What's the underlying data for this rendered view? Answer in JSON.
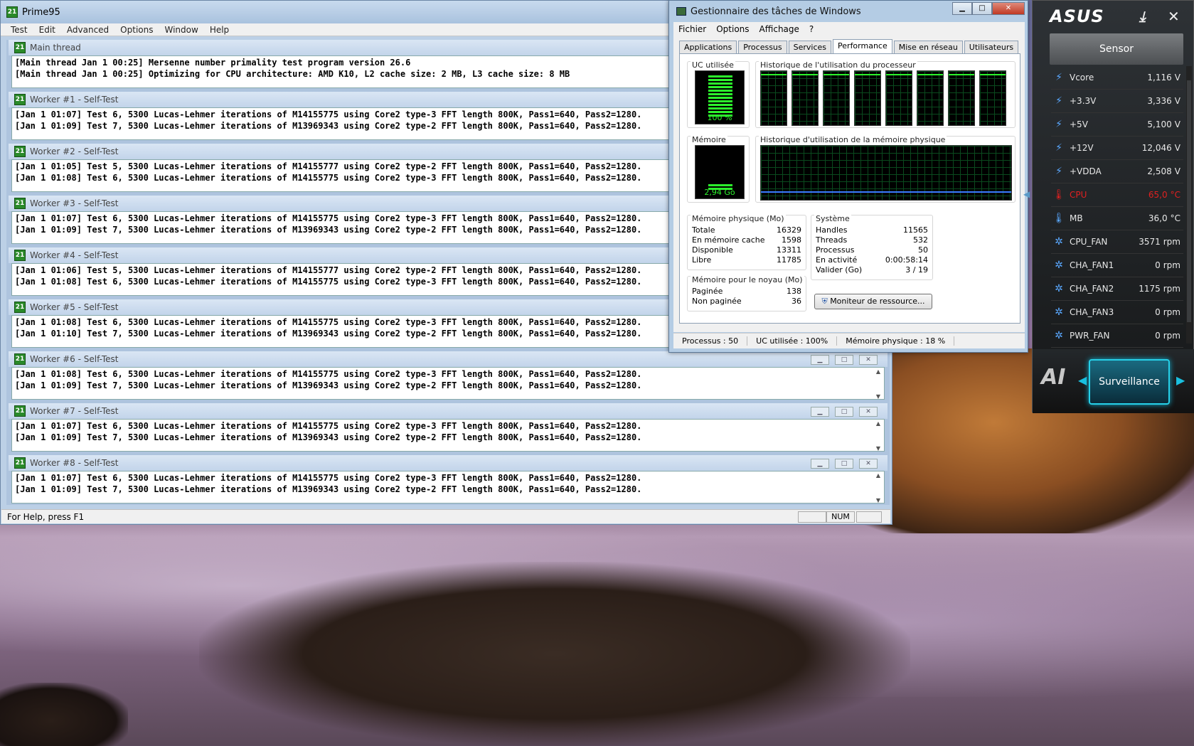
{
  "prime95": {
    "title": "Prime95",
    "menu": [
      "Test",
      "Edit",
      "Advanced",
      "Options",
      "Window",
      "Help"
    ],
    "windows": [
      {
        "title": "Main thread",
        "lines": [
          "[Main thread Jan 1 00:25] Mersenne number primality test program version 26.6",
          "[Main thread Jan 1 00:25] Optimizing for CPU architecture: AMD K10, L2 cache size: 2 MB, L3 cache size: 8 MB"
        ]
      },
      {
        "title": "Worker #1 - Self-Test",
        "lines": [
          "[Jan 1 01:07] Test 6, 5300 Lucas-Lehmer iterations of M14155775 using Core2 type-3 FFT length 800K, Pass1=640, Pass2=1280.",
          "[Jan 1 01:09] Test 7, 5300 Lucas-Lehmer iterations of M13969343 using Core2 type-2 FFT length 800K, Pass1=640, Pass2=1280."
        ]
      },
      {
        "title": "Worker #2 - Self-Test",
        "lines": [
          "[Jan 1 01:05] Test 5, 5300 Lucas-Lehmer iterations of M14155777 using Core2 type-2 FFT length 800K, Pass1=640, Pass2=1280.",
          "[Jan 1 01:08] Test 6, 5300 Lucas-Lehmer iterations of M14155775 using Core2 type-3 FFT length 800K, Pass1=640, Pass2=1280."
        ]
      },
      {
        "title": "Worker #3 - Self-Test",
        "lines": [
          "[Jan 1 01:07] Test 6, 5300 Lucas-Lehmer iterations of M14155775 using Core2 type-3 FFT length 800K, Pass1=640, Pass2=1280.",
          "[Jan 1 01:09] Test 7, 5300 Lucas-Lehmer iterations of M13969343 using Core2 type-2 FFT length 800K, Pass1=640, Pass2=1280."
        ]
      },
      {
        "title": "Worker #4 - Self-Test",
        "lines": [
          "[Jan 1 01:06] Test 5, 5300 Lucas-Lehmer iterations of M14155777 using Core2 type-2 FFT length 800K, Pass1=640, Pass2=1280.",
          "[Jan 1 01:08] Test 6, 5300 Lucas-Lehmer iterations of M14155775 using Core2 type-3 FFT length 800K, Pass1=640, Pass2=1280."
        ]
      },
      {
        "title": "Worker #5 - Self-Test",
        "lines": [
          "[Jan 1 01:08] Test 6, 5300 Lucas-Lehmer iterations of M14155775 using Core2 type-3 FFT length 800K, Pass1=640, Pass2=1280.",
          "[Jan 1 01:10] Test 7, 5300 Lucas-Lehmer iterations of M13969343 using Core2 type-2 FFT length 800K, Pass1=640, Pass2=1280."
        ]
      },
      {
        "title": "Worker #6 - Self-Test",
        "lines": [
          "[Jan 1 01:08] Test 6, 5300 Lucas-Lehmer iterations of M14155775 using Core2 type-3 FFT length 800K, Pass1=640, Pass2=1280.",
          "[Jan 1 01:09] Test 7, 5300 Lucas-Lehmer iterations of M13969343 using Core2 type-2 FFT length 800K, Pass1=640, Pass2=1280."
        ]
      },
      {
        "title": "Worker #7 - Self-Test",
        "lines": [
          "[Jan 1 01:07] Test 6, 5300 Lucas-Lehmer iterations of M14155775 using Core2 type-3 FFT length 800K, Pass1=640, Pass2=1280.",
          "[Jan 1 01:09] Test 7, 5300 Lucas-Lehmer iterations of M13969343 using Core2 type-2 FFT length 800K, Pass1=640, Pass2=1280."
        ]
      },
      {
        "title": "Worker #8 - Self-Test",
        "lines": [
          "[Jan 1 01:07] Test 6, 5300 Lucas-Lehmer iterations of M14155775 using Core2 type-3 FFT length 800K, Pass1=640, Pass2=1280.",
          "[Jan 1 01:09] Test 7, 5300 Lucas-Lehmer iterations of M13969343 using Core2 type-2 FFT length 800K, Pass1=640, Pass2=1280."
        ]
      }
    ],
    "status_help": "For Help, press F1",
    "status_num": "NUM"
  },
  "taskmgr": {
    "title": "Gestionnaire des tâches de Windows",
    "menu": [
      "Fichier",
      "Options",
      "Affichage",
      "?"
    ],
    "tabs": [
      "Applications",
      "Processus",
      "Services",
      "Performance",
      "Mise en réseau",
      "Utilisateurs"
    ],
    "active_tab": "Performance",
    "cpu_label": "UC utilisée",
    "cpu_value": "100 %",
    "cpu_fraction": 1.0,
    "cpu_history_label": "Historique de l'utilisation du processeur",
    "mem_label": "Mémoire",
    "mem_value": "2,94 Go",
    "mem_fraction": 0.18,
    "mem_history_label": "Historique d'utilisation de la mémoire physique",
    "phys_mem": {
      "label": "Mémoire physique (Mo)",
      "rows": [
        [
          "Totale",
          "16329"
        ],
        [
          "En mémoire cache",
          "1598"
        ],
        [
          "Disponible",
          "13311"
        ],
        [
          "Libre",
          "11785"
        ]
      ]
    },
    "system": {
      "label": "Système",
      "rows": [
        [
          "Handles",
          "11565"
        ],
        [
          "Threads",
          "532"
        ],
        [
          "Processus",
          "50"
        ],
        [
          "En activité",
          "0:00:58:14"
        ],
        [
          "Valider (Go)",
          "3 / 19"
        ]
      ]
    },
    "kernel_mem": {
      "label": "Mémoire pour le noyau (Mo)",
      "rows": [
        [
          "Paginée",
          "138"
        ],
        [
          "Non paginée",
          "36"
        ]
      ]
    },
    "resource_button": "Moniteur de ressource...",
    "status": [
      "Processus : 50",
      "UC utilisée : 100%",
      "Mémoire physique : 18 %"
    ]
  },
  "asus": {
    "logo": "ASUS",
    "panel": "Sensor",
    "sensors": [
      {
        "name": "Vcore",
        "value": "1,116",
        "unit": "V",
        "icon": "bolt-icon"
      },
      {
        "name": "+3.3V",
        "value": "3,336",
        "unit": "V",
        "icon": "bolt-icon"
      },
      {
        "name": "+5V",
        "value": "5,100",
        "unit": "V",
        "icon": "bolt-icon"
      },
      {
        "name": "+12V",
        "value": "12,046",
        "unit": "V",
        "icon": "bolt-icon"
      },
      {
        "name": "+VDDA",
        "value": "2,508",
        "unit": "V",
        "icon": "bolt-icon"
      },
      {
        "name": "CPU",
        "value": "65,0",
        "unit": "°C",
        "icon": "thermometer-icon",
        "alert": true
      },
      {
        "name": "MB",
        "value": "36,0",
        "unit": "°C",
        "icon": "thermometer-icon"
      },
      {
        "name": "CPU_FAN",
        "value": "3571",
        "unit": "rpm",
        "icon": "fan-icon"
      },
      {
        "name": "CHA_FAN1",
        "value": "0",
        "unit": "rpm",
        "icon": "fan-icon"
      },
      {
        "name": "CHA_FAN2",
        "value": "1175",
        "unit": "rpm",
        "icon": "fan-icon"
      },
      {
        "name": "CHA_FAN3",
        "value": "0",
        "unit": "rpm",
        "icon": "fan-icon"
      },
      {
        "name": "PWR_FAN",
        "value": "0",
        "unit": "rpm",
        "icon": "fan-icon"
      }
    ],
    "button": "Surveillance",
    "ai_logo": "AI",
    "alert_color": "#e02020"
  }
}
